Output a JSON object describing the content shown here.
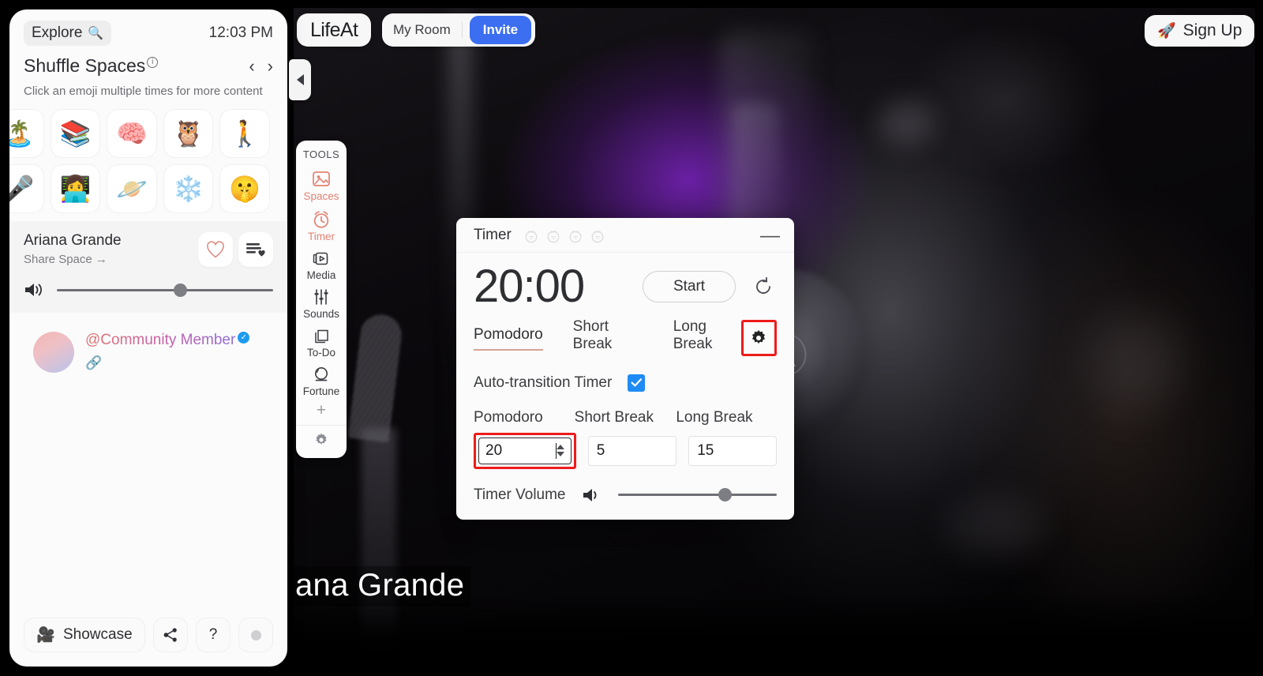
{
  "topbar": {
    "brand": "LifeAt",
    "room_label": "My Room",
    "invite_label": "Invite",
    "signup_label": "Sign Up",
    "signup_icon": "rocket-icon"
  },
  "sidebar": {
    "explore_label": "Explore",
    "explore_icon": "magnifying-glass-icon",
    "clock": "12:03 PM",
    "shuffle_title": "Shuffle Spaces",
    "info_icon": "info-circle-icon",
    "prev_icon": "chevron-left-icon",
    "next_icon": "chevron-right-icon",
    "hint": "Click an emoji multiple times for more content",
    "emojis": [
      {
        "name": "palm-tree-emoji",
        "glyph": "🏝️"
      },
      {
        "name": "books-emoji",
        "glyph": "📚"
      },
      {
        "name": "brain-emoji",
        "glyph": "🧠"
      },
      {
        "name": "owl-emoji",
        "glyph": "🦉"
      },
      {
        "name": "walking-person-emoji",
        "glyph": "🚶"
      },
      {
        "name": "microphone-emoji",
        "glyph": "🎤"
      },
      {
        "name": "woman-with-laptop-emoji",
        "glyph": "👩‍💻"
      },
      {
        "name": "ringed-planet-emoji",
        "glyph": "🪐"
      },
      {
        "name": "snowflake-emoji",
        "glyph": "❄️"
      },
      {
        "name": "shushing-face-emoji",
        "glyph": "🤫"
      }
    ],
    "space": {
      "name": "Ariana Grande",
      "share_label": "Share Space →",
      "favorite_icon": "heart-icon",
      "playlist_icon": "playlist-heart-icon",
      "volume_icon": "speaker-icon",
      "volume_percent": 57
    },
    "member": {
      "handle": "@Community Member",
      "verified_icon": "verified-check-icon",
      "link_icon": "link-icon",
      "avatar": "avatar"
    },
    "footer": {
      "showcase_label": "Showcase",
      "showcase_icon": "movie-camera-emoji",
      "share_icon": "share-icon",
      "help_label": "?",
      "status_icon": "status-dot-icon"
    },
    "collapse_icon": "collapse-left-icon"
  },
  "tools": {
    "title": "TOOLS",
    "items": [
      {
        "label": "Spaces",
        "icon": "image-icon",
        "active": true
      },
      {
        "label": "Timer",
        "icon": "alarm-clock-icon",
        "active": true
      },
      {
        "label": "Media",
        "icon": "media-player-icon",
        "active": false
      },
      {
        "label": "Sounds",
        "icon": "sliders-icon",
        "active": false
      },
      {
        "label": "To-Do",
        "icon": "notes-icon",
        "active": false
      },
      {
        "label": "Fortune",
        "icon": "crystal-ball-icon",
        "active": false
      }
    ],
    "add_label": "+",
    "settings_icon": "gear-icon"
  },
  "timer": {
    "title": "Timer",
    "pomodoro_marks": 4,
    "mark_icon": "tomato-icon",
    "minimize_icon": "minimize-icon",
    "display": "20:00",
    "start_label": "Start",
    "reset_icon": "reset-icon",
    "tabs": [
      {
        "label": "Pomodoro",
        "active": true
      },
      {
        "label": "Short Break",
        "active": false
      },
      {
        "label": "Long Break",
        "active": false
      }
    ],
    "settings_icon": "gear-icon",
    "settings": {
      "auto_transition_label": "Auto-transition Timer",
      "auto_transition_checked": true,
      "durations": [
        {
          "label": "Pomodoro",
          "value": "20",
          "focused": true
        },
        {
          "label": "Short Break",
          "value": "5",
          "focused": false
        },
        {
          "label": "Long Break",
          "value": "15",
          "focused": false
        }
      ],
      "volume_label": "Timer Volume",
      "volume_icon": "speaker-icon",
      "volume_percent": 67
    }
  },
  "video": {
    "caption": "ana Grande"
  },
  "colors": {
    "accent_coral": "#e38272",
    "invite_blue": "#3b6ef0",
    "checkbox_blue": "#1f8bf4",
    "highlight_red": "#ee1b1b",
    "tab_underline": "#d9a197"
  }
}
